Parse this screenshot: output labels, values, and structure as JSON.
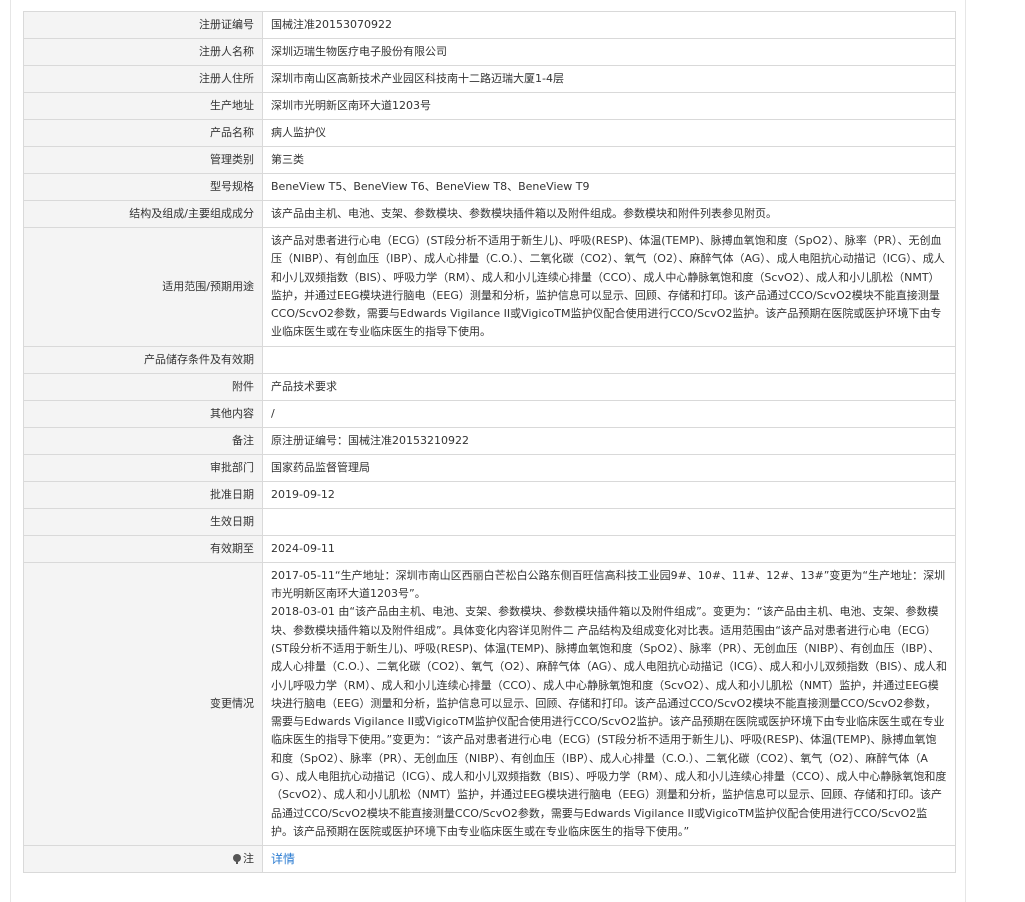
{
  "rows": [
    {
      "label": "注册证编号",
      "value": "国械注准20153070922"
    },
    {
      "label": "注册人名称",
      "value": "深圳迈瑞生物医疗电子股份有限公司"
    },
    {
      "label": "注册人住所",
      "value": "深圳市南山区高新技术产业园区科技南十二路迈瑞大厦1-4层"
    },
    {
      "label": "生产地址",
      "value": "深圳市光明新区南环大道1203号"
    },
    {
      "label": "产品名称",
      "value": "病人监护仪"
    },
    {
      "label": "管理类别",
      "value": "第三类"
    },
    {
      "label": "型号规格",
      "value": "BeneView T5、BeneView T6、BeneView T8、BeneView T9"
    },
    {
      "label": "结构及组成/主要组成成分",
      "value": "该产品由主机、电池、支架、参数模块、参数模块插件箱以及附件组成。参数模块和附件列表参见附页。"
    },
    {
      "label": "适用范围/预期用途",
      "value": "该产品对患者进行心电（ECG）(ST段分析不适用于新生儿)、呼吸(RESP)、体温(TEMP)、脉搏血氧饱和度（SpO2）、脉率（PR）、无创血压（NIBP）、有创血压（IBP）、成人心排量（C.O.）、二氧化碳（CO2）、氧气（O2）、麻醉气体（AG）、成人电阻抗心动描记（ICG）、成人和小儿双频指数（BIS）、呼吸力学（RM）、成人和小儿连续心排量（CCO）、成人中心静脉氧饱和度（ScvO2）、成人和小儿肌松（NMT）监护，并通过EEG模块进行脑电（EEG）测量和分析，监护信息可以显示、回顾、存储和打印。该产品通过CCO/ScvO2模块不能直接测量CCO/ScvO2参数，需要与Edwards Vigilance II或VigicoTM监护仪配合使用进行CCO/ScvO2监护。该产品预期在医院或医护环境下由专业临床医生或在专业临床医生的指导下使用。"
    },
    {
      "label": "产品储存条件及有效期",
      "value": ""
    },
    {
      "label": "附件",
      "value": "产品技术要求"
    },
    {
      "label": "其他内容",
      "value": "/"
    },
    {
      "label": "备注",
      "value": "原注册证编号：国械注准20153210922"
    },
    {
      "label": "审批部门",
      "value": "国家药品监督管理局"
    },
    {
      "label": "批准日期",
      "value": "2019-09-12"
    },
    {
      "label": "生效日期",
      "value": ""
    },
    {
      "label": "有效期至",
      "value": "2024-09-11"
    },
    {
      "label": "变更情况",
      "value_lines": [
        "2017-05-11“生产地址：深圳市南山区西丽白芒松白公路东侧百旺信高科技工业园9#、10#、11#、12#、13#”变更为“生产地址：深圳市光明新区南环大道1203号”。",
        "2018-03-01 由“该产品由主机、电池、支架、参数模块、参数模块插件箱以及附件组成”。变更为：“该产品由主机、电池、支架、参数模块、参数模块插件箱以及附件组成”。具体变化内容详见附件二 产品结构及组成变化对比表。适用范围由“该产品对患者进行心电（ECG）(ST段分析不适用于新生儿)、呼吸(RESP)、体温(TEMP)、脉搏血氧饱和度（SpO2）、脉率（PR）、无创血压（NIBP）、有创血压（IBP）、成人心排量（C.O.）、二氧化碳（CO2）、氧气（O2）、麻醉气体（AG）、成人电阻抗心动描记（ICG）、成人和小儿双频指数（BIS）、成人和小儿呼吸力学（RM）、成人和小儿连续心排量（CCO）、成人中心静脉氧饱和度（ScvO2）、成人和小儿肌松（NMT）监护，并通过EEG模块进行脑电（EEG）测量和分析，监护信息可以显示、回顾、存储和打印。该产品通过CCO/ScvO2模块不能直接测量CCO/ScvO2参数，需要与Edwards Vigilance II或VigicoTM监护仪配合使用进行CCO/ScvO2监护。该产品预期在医院或医护环境下由专业临床医生或在专业临床医生的指导下使用。”变更为：“该产品对患者进行心电（ECG）(ST段分析不适用于新生儿)、呼吸(RESP)、体温(TEMP)、脉搏血氧饱和度（SpO2）、脉率（PR）、无创血压（NIBP）、有创血压（IBP）、成人心排量（C.O.）、二氧化碳（CO2）、氧气（O2）、麻醉气体（AG）、成人电阻抗心动描记（ICG）、成人和小儿双频指数（BIS）、呼吸力学（RM）、成人和小儿连续心排量（CCO）、成人中心静脉氧饱和度（ScvO2）、成人和小儿肌松（NMT）监护，并通过EEG模块进行脑电（EEG）测量和分析，监护信息可以显示、回顾、存储和打印。该产品通过CCO/ScvO2模块不能直接测量CCO/ScvO2参数，需要与Edwards Vigilance II或VigicoTM监护仪配合使用进行CCO/ScvO2监护。该产品预期在医院或医护环境下由专业临床医生或在专业临床医生的指导下使用。”"
      ]
    },
    {
      "label": "注",
      "link": "详情",
      "icon": "pin-icon"
    }
  ]
}
